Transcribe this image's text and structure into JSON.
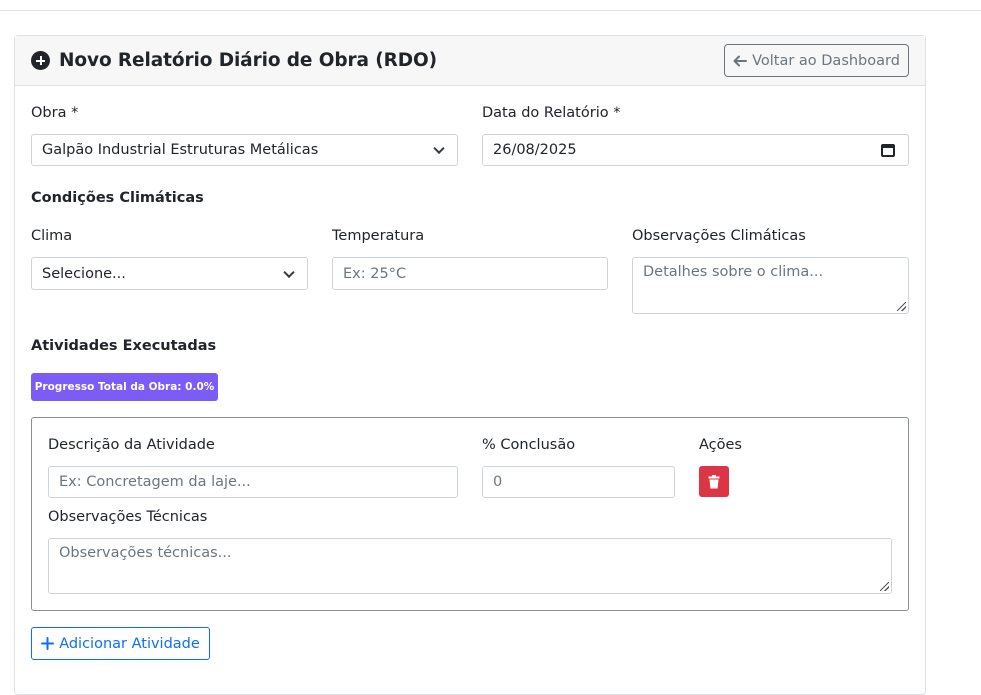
{
  "header": {
    "title": "Novo Relatório Diário de Obra (RDO)",
    "back_label": "Voltar ao Dashboard"
  },
  "form": {
    "obra_label": "Obra *",
    "obra_value": "Galpão Industrial Estruturas Metálicas",
    "data_label": "Data do Relatório *",
    "data_value": "26/08/2025"
  },
  "clima": {
    "section_title": "Condições Climáticas",
    "clima_label": "Clima",
    "clima_value": "Selecione...",
    "temp_label": "Temperatura",
    "temp_placeholder": "Ex: 25°C",
    "obs_label": "Observações Climáticas",
    "obs_placeholder": "Detalhes sobre o clima..."
  },
  "atividades": {
    "section_title": "Atividades Executadas",
    "progress_badge": "Progresso Total da Obra: 0.0%",
    "progress_percent": 0.0,
    "desc_label": "Descrição da Atividade",
    "desc_placeholder": "Ex: Concretagem da laje...",
    "conclusao_label": "% Conclusão",
    "conclusao_value": "0",
    "acoes_label": "Ações",
    "obs_label": "Observações Técnicas",
    "obs_placeholder": "Observações técnicas...",
    "add_label": "Adicionar Atividade"
  },
  "icons": {
    "header_icon": "plus-circle-icon",
    "back_icon": "arrow-left-icon",
    "delete_icon": "trash-icon",
    "add_icon": "plus-icon",
    "date_icon": "calendar-icon"
  },
  "colors": {
    "badge": "#7c5cf6",
    "danger": "#dc3545",
    "primary": "#0d6efd",
    "secondary": "#6c757d"
  }
}
